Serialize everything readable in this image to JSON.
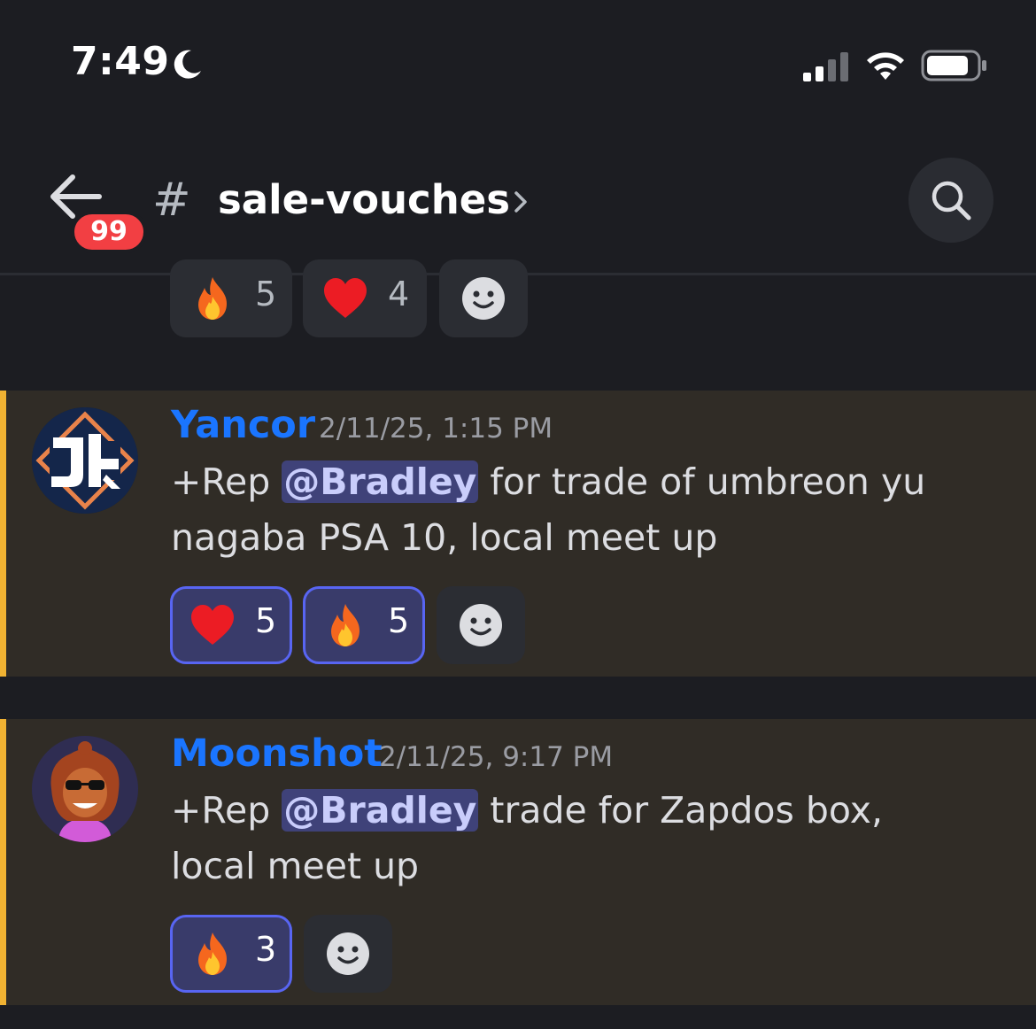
{
  "status_bar": {
    "time": "7:49",
    "icons": [
      "moon-icon",
      "cellular-signal-icon",
      "wifi-icon",
      "battery-icon"
    ]
  },
  "header": {
    "back_icon": "back-arrow-icon",
    "unread_count": "99",
    "channel_hash": "#",
    "channel_name": "sale-vouches",
    "chevron_icon": "chevron-right-icon",
    "search_icon": "search-icon"
  },
  "previous_message": {
    "reactions": [
      {
        "emoji": "fire-emoji",
        "count": "5",
        "active": false
      },
      {
        "emoji": "heart-emoji",
        "count": "4",
        "active": false
      }
    ],
    "add_reaction_icon": "add-reaction-icon"
  },
  "messages": [
    {
      "author": "Yancor",
      "timestamp": "2/11/25, 1:15 PM",
      "text_before": "+Rep ",
      "mention": "@Bradley",
      "text_after": " for trade of umbreon yu nagaba PSA 10, local meet up",
      "reactions": [
        {
          "emoji": "heart-emoji",
          "count": "5",
          "active": true
        },
        {
          "emoji": "fire-emoji",
          "count": "5",
          "active": true
        }
      ]
    },
    {
      "author": "Moonshot",
      "timestamp": "2/11/25, 9:17 PM",
      "text_before": "+Rep ",
      "mention": "@Bradley",
      "text_after": " trade for Zapdos box, local meet up",
      "reactions": [
        {
          "emoji": "fire-emoji",
          "count": "3",
          "active": true
        }
      ]
    }
  ],
  "colors": {
    "background": "#1c1d22",
    "highlight_background": "#302c26",
    "highlight_bar": "#f0b232",
    "username": "#1a75ff",
    "mention_bg": "#3f4279",
    "badge": "#f23f43",
    "reaction_active_border": "#5865f2"
  }
}
